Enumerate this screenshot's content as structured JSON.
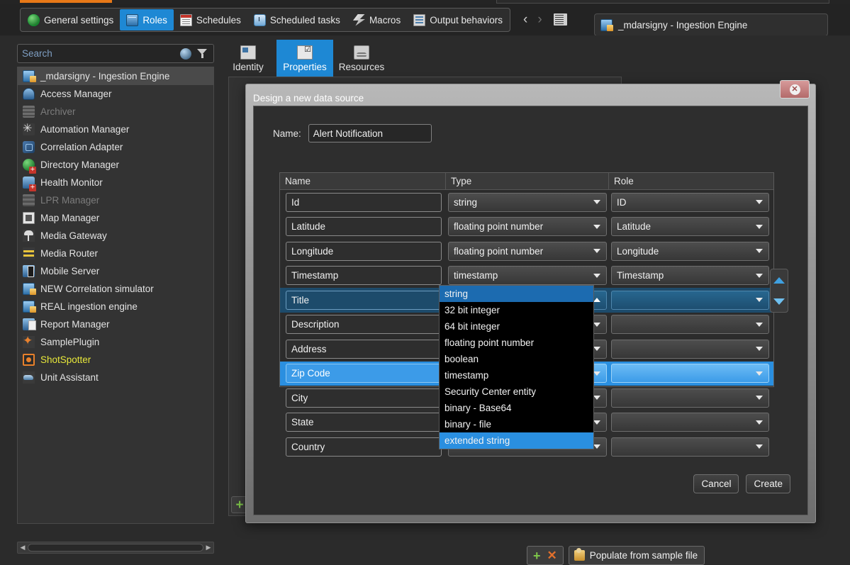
{
  "toolbar": {
    "tabs": [
      {
        "label": "General settings",
        "icon": "globe-icon",
        "active": false
      },
      {
        "label": "Roles",
        "icon": "roles-icon",
        "active": true
      },
      {
        "label": "Schedules",
        "icon": "calendar-icon",
        "active": false
      },
      {
        "label": "Scheduled tasks",
        "icon": "clock-icon",
        "active": false
      },
      {
        "label": "Macros",
        "icon": "macro-icon",
        "active": false
      },
      {
        "label": "Output behaviors",
        "icon": "output-icon",
        "active": false
      }
    ],
    "nav_back": "‹",
    "nav_forward": "›",
    "window_icon": "window-restore-icon",
    "breadcrumb": "_mdarsigny - Ingestion Engine",
    "breadcrumb_icon": "ingestion-engine-icon"
  },
  "sidebar": {
    "search": {
      "placeholder": "Search",
      "globe_icon": "globe-icon",
      "filter_icon": "funnel-icon"
    },
    "items": [
      {
        "label": "_mdarsigny - Ingestion Engine",
        "icon": "i-ingestion",
        "state": "selected"
      },
      {
        "label": "Access Manager",
        "icon": "i-access",
        "state": "normal"
      },
      {
        "label": "Archiver",
        "icon": "i-archiver",
        "state": "disabled"
      },
      {
        "label": "Automation Manager",
        "icon": "i-automation",
        "state": "normal"
      },
      {
        "label": "Correlation Adapter",
        "icon": "i-correlation",
        "state": "normal"
      },
      {
        "label": "Directory Manager",
        "icon": "i-directory",
        "state": "normal"
      },
      {
        "label": "Health Monitor",
        "icon": "i-health",
        "state": "normal"
      },
      {
        "label": "LPR Manager",
        "icon": "i-lpr",
        "state": "disabled"
      },
      {
        "label": "Map Manager",
        "icon": "i-map",
        "state": "normal"
      },
      {
        "label": "Media Gateway",
        "icon": "i-gateway",
        "state": "normal"
      },
      {
        "label": "Media Router",
        "icon": "i-router",
        "state": "normal"
      },
      {
        "label": "Mobile Server",
        "icon": "i-mobile",
        "state": "normal"
      },
      {
        "label": "NEW Correlation simulator",
        "icon": "i-ingestion",
        "state": "normal"
      },
      {
        "label": "REAL ingestion engine",
        "icon": "i-ingestion",
        "state": "normal"
      },
      {
        "label": "Report Manager",
        "icon": "i-report",
        "state": "normal"
      },
      {
        "label": "SamplePlugin",
        "icon": "i-plugin",
        "state": "normal"
      },
      {
        "label": "ShotSpotter",
        "icon": "i-shot",
        "state": "yellow"
      },
      {
        "label": "Unit Assistant",
        "icon": "i-unit",
        "state": "normal"
      }
    ],
    "hscroll": {
      "left_arrow": "◀",
      "right_arrow": "▶"
    }
  },
  "view_tabs": [
    {
      "label": "Identity",
      "icon": "identity-icon",
      "active": false
    },
    {
      "label": "Properties",
      "icon": "properties-icon",
      "active": true
    },
    {
      "label": "Resources",
      "icon": "resources-icon",
      "active": false
    }
  ],
  "content": {
    "add_button": "+"
  },
  "dialog": {
    "title": "Design a new data source",
    "close_label": "✕",
    "name_label": "Name:",
    "name_value": "Alert Notification",
    "columns": [
      "Name",
      "Type",
      "Role"
    ],
    "rows": [
      {
        "name": "Id",
        "type": "string",
        "role": "ID",
        "state": "normal"
      },
      {
        "name": "Latitude",
        "type": "floating point number",
        "role": "Latitude",
        "state": "normal"
      },
      {
        "name": "Longitude",
        "type": "floating point number",
        "role": "Longitude",
        "state": "normal"
      },
      {
        "name": "Timestamp",
        "type": "timestamp",
        "role": "Timestamp",
        "state": "normal"
      },
      {
        "name": "Title",
        "type": "string",
        "role": "",
        "state": "selected-unfocused",
        "dropdown_open": true
      },
      {
        "name": "Description",
        "type": "",
        "role": "",
        "state": "normal"
      },
      {
        "name": "Address",
        "type": "",
        "role": "",
        "state": "normal"
      },
      {
        "name": "Zip Code",
        "type": "",
        "role": "",
        "state": "selected-focused"
      },
      {
        "name": "City",
        "type": "",
        "role": "",
        "state": "normal"
      },
      {
        "name": "State",
        "type": "",
        "role": "",
        "state": "normal"
      },
      {
        "name": "Country",
        "type": "",
        "role": "",
        "state": "normal"
      }
    ],
    "type_options": [
      {
        "label": "string",
        "state": "highlighted"
      },
      {
        "label": "32 bit integer",
        "state": "normal"
      },
      {
        "label": "64 bit integer",
        "state": "normal"
      },
      {
        "label": "floating point number",
        "state": "normal"
      },
      {
        "label": "boolean",
        "state": "normal"
      },
      {
        "label": "timestamp",
        "state": "normal"
      },
      {
        "label": "Security Center entity",
        "state": "normal"
      },
      {
        "label": "binary - Base64",
        "state": "normal"
      },
      {
        "label": "binary - file",
        "state": "normal"
      },
      {
        "label": "extended string",
        "state": "selected"
      }
    ],
    "grid_tools": {
      "add": "+",
      "remove": "✕",
      "populate_label": "Populate from sample file",
      "populate_icon": "sample-file-icon"
    },
    "reorder": {
      "up": "move-up",
      "down": "move-down"
    },
    "cancel_label": "Cancel",
    "create_label": "Create"
  },
  "colors": {
    "accent_blue": "#1e88d4",
    "selected_focus": "#2a8fe0",
    "selected_unfocus": "#1d4b6b",
    "orange_strip": "#e77817",
    "yellow_role": "#e8e83a",
    "window_bg": "#2b2b2b"
  }
}
